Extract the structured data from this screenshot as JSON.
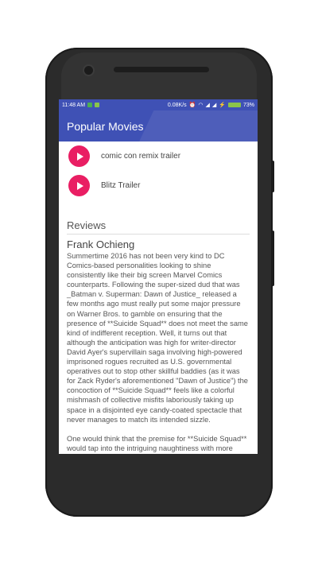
{
  "status_bar": {
    "time": "11:48 AM",
    "speed": "0.08K/s",
    "battery": "73%"
  },
  "app": {
    "title": "Popular Movies"
  },
  "trailers": [
    {
      "label": "comic con remix trailer"
    },
    {
      "label": "Blitz Trailer"
    }
  ],
  "reviews_section": {
    "title": "Reviews"
  },
  "reviews": [
    {
      "author": "Frank Ochieng",
      "content": "Summertime 2016 has not been very kind to DC Comics-based personalities looking to shine consistently like their big screen Marvel Comics counterparts. Following the super-sized dud that was _Batman v. Superman: Dawn of Justice_ released a few months ago must really put some major pressure on Warner Bros. to gamble on ensuring that the presence of **Suicide Squad** does not meet the same kind of indifferent reception. Well, it turns out that although the anticipation was high for writer-director David Ayer's supervillain saga involving high-powered imprisoned rogues recruited as U.S. governmental operatives out to stop other skillful baddies (as it was for Zack Ryder's aforementioned \"Dawn of Justice\") the concoction of **Suicide Squad** feels like a colorful mishmash of collective misfits laboriously taking up space in a disjointed eye candy-coated spectacle that never manages to match its intended sizzle.\n\nOne would think that the premise for **Suicide Squad** would tap into the intriguing naughtiness with more robust gumption given the collection of"
    }
  ],
  "colors": {
    "primary": "#3f51b5",
    "accent": "#e91e63"
  }
}
